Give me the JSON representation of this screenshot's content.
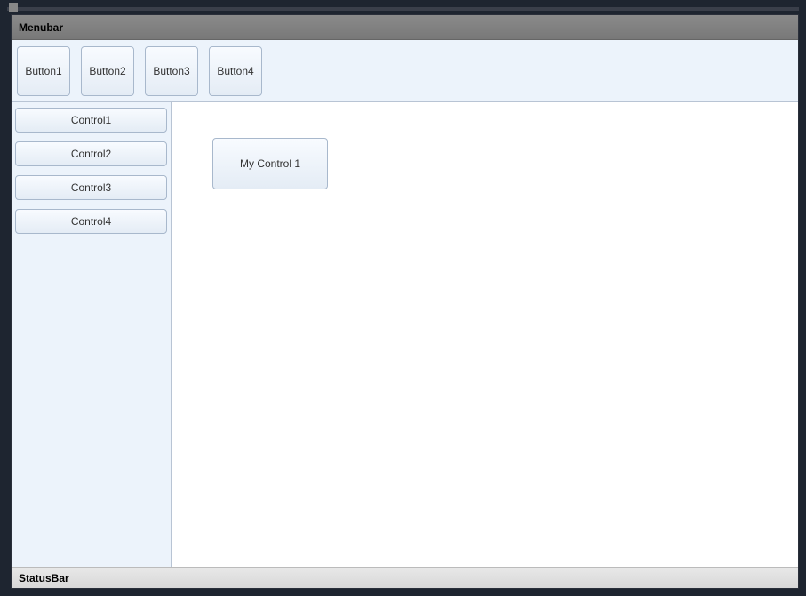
{
  "menubar": {
    "label": "Menubar"
  },
  "toolbar": {
    "buttons": [
      {
        "label": "Button1"
      },
      {
        "label": "Button2"
      },
      {
        "label": "Button3"
      },
      {
        "label": "Button4"
      }
    ]
  },
  "sidebar": {
    "controls": [
      {
        "label": "Control1"
      },
      {
        "label": "Control2"
      },
      {
        "label": "Control3"
      },
      {
        "label": "Control4"
      }
    ]
  },
  "content": {
    "control_label": "My Control 1"
  },
  "statusbar": {
    "label": "StatusBar"
  }
}
